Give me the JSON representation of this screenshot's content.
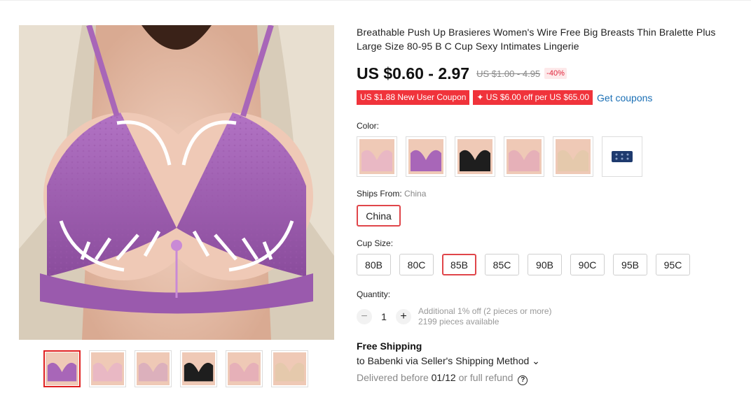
{
  "product": {
    "title": "Breathable Push Up Brasieres Women's Wire Free Big Breasts Thin Bralette Plus Large Size 80-95 B C Cup Sexy Intimates Lingerie"
  },
  "gallery": {
    "thumb_colors": [
      "#a866b8",
      "#e9b8c4",
      "#dcb0bc",
      "#1e1e1e",
      "#e6b0b8",
      "#e5c9ac"
    ],
    "active_index": 0
  },
  "pricing": {
    "price": "US $0.60 - 2.97",
    "original": "US $1.00 - 4.95",
    "discount": "-40%"
  },
  "coupons": {
    "new_user": "US $1.88 New User Coupon",
    "spend": "✦ US $6.00 off per US $65.00",
    "link": "Get coupons"
  },
  "color": {
    "label": "Color:",
    "swatches": [
      "#e9b8c4",
      "#a866b8",
      "#1e1e1e",
      "#e6b0b8",
      "#e5c9ac",
      "#1e3a6e"
    ]
  },
  "ships_from": {
    "label": "Ships From:",
    "value": "China",
    "option": "China"
  },
  "cup_size": {
    "label": "Cup Size:",
    "options": [
      "80B",
      "80C",
      "85B",
      "85C",
      "90B",
      "90C",
      "95B",
      "95C"
    ],
    "selected": "85B"
  },
  "quantity": {
    "label": "Quantity:",
    "minus": "−",
    "value": "1",
    "plus": "+",
    "promo": "Additional 1% off (2 pieces or more)",
    "available": "2199 pieces available"
  },
  "shipping": {
    "title": "Free Shipping",
    "method": "to Babenki via Seller's Shipping Method",
    "chevron": "⌄",
    "delivered_prefix": "Delivered before",
    "date": "01/12",
    "delivered_suffix": "or full refund",
    "help": "?"
  }
}
